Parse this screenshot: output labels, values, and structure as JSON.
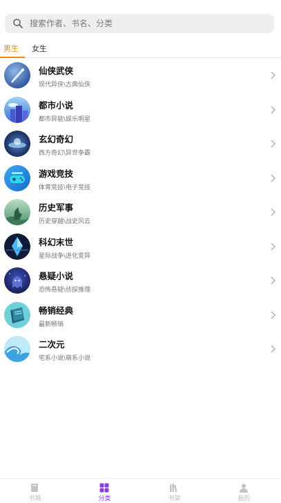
{
  "search": {
    "placeholder": "搜索作者、书名、分类",
    "icon": "search-icon"
  },
  "gender_tabs": [
    {
      "label": "男生",
      "active": true
    },
    {
      "label": "女生",
      "active": false
    }
  ],
  "accent_color": "#f08a0f",
  "nav_active_color": "#8b3be6",
  "categories": [
    {
      "title": "仙侠武侠",
      "subtitle": "现代异侠\\古典仙侠"
    },
    {
      "title": "都市小说",
      "subtitle": "都市异能\\娱乐明星"
    },
    {
      "title": "玄幻奇幻",
      "subtitle": "西方奇幻\\异世争霸"
    },
    {
      "title": "游戏竞技",
      "subtitle": "体育竞技\\电子竞技"
    },
    {
      "title": "历史军事",
      "subtitle": "历史穿越\\战史风云"
    },
    {
      "title": "科幻末世",
      "subtitle": "星际战争\\进化变异"
    },
    {
      "title": "悬疑小说",
      "subtitle": "恐怖悬疑\\侦探推理"
    },
    {
      "title": "畅销经典",
      "subtitle": "最新畅销"
    },
    {
      "title": "二次元",
      "subtitle": "宅系小说\\萌系小说"
    }
  ],
  "bottom_nav": [
    {
      "label": "书城",
      "icon": "book-icon",
      "active": false
    },
    {
      "label": "分类",
      "icon": "grid-icon",
      "active": true
    },
    {
      "label": "书架",
      "icon": "bookshelf-icon",
      "active": false
    },
    {
      "label": "我的",
      "icon": "user-icon",
      "active": false
    }
  ]
}
